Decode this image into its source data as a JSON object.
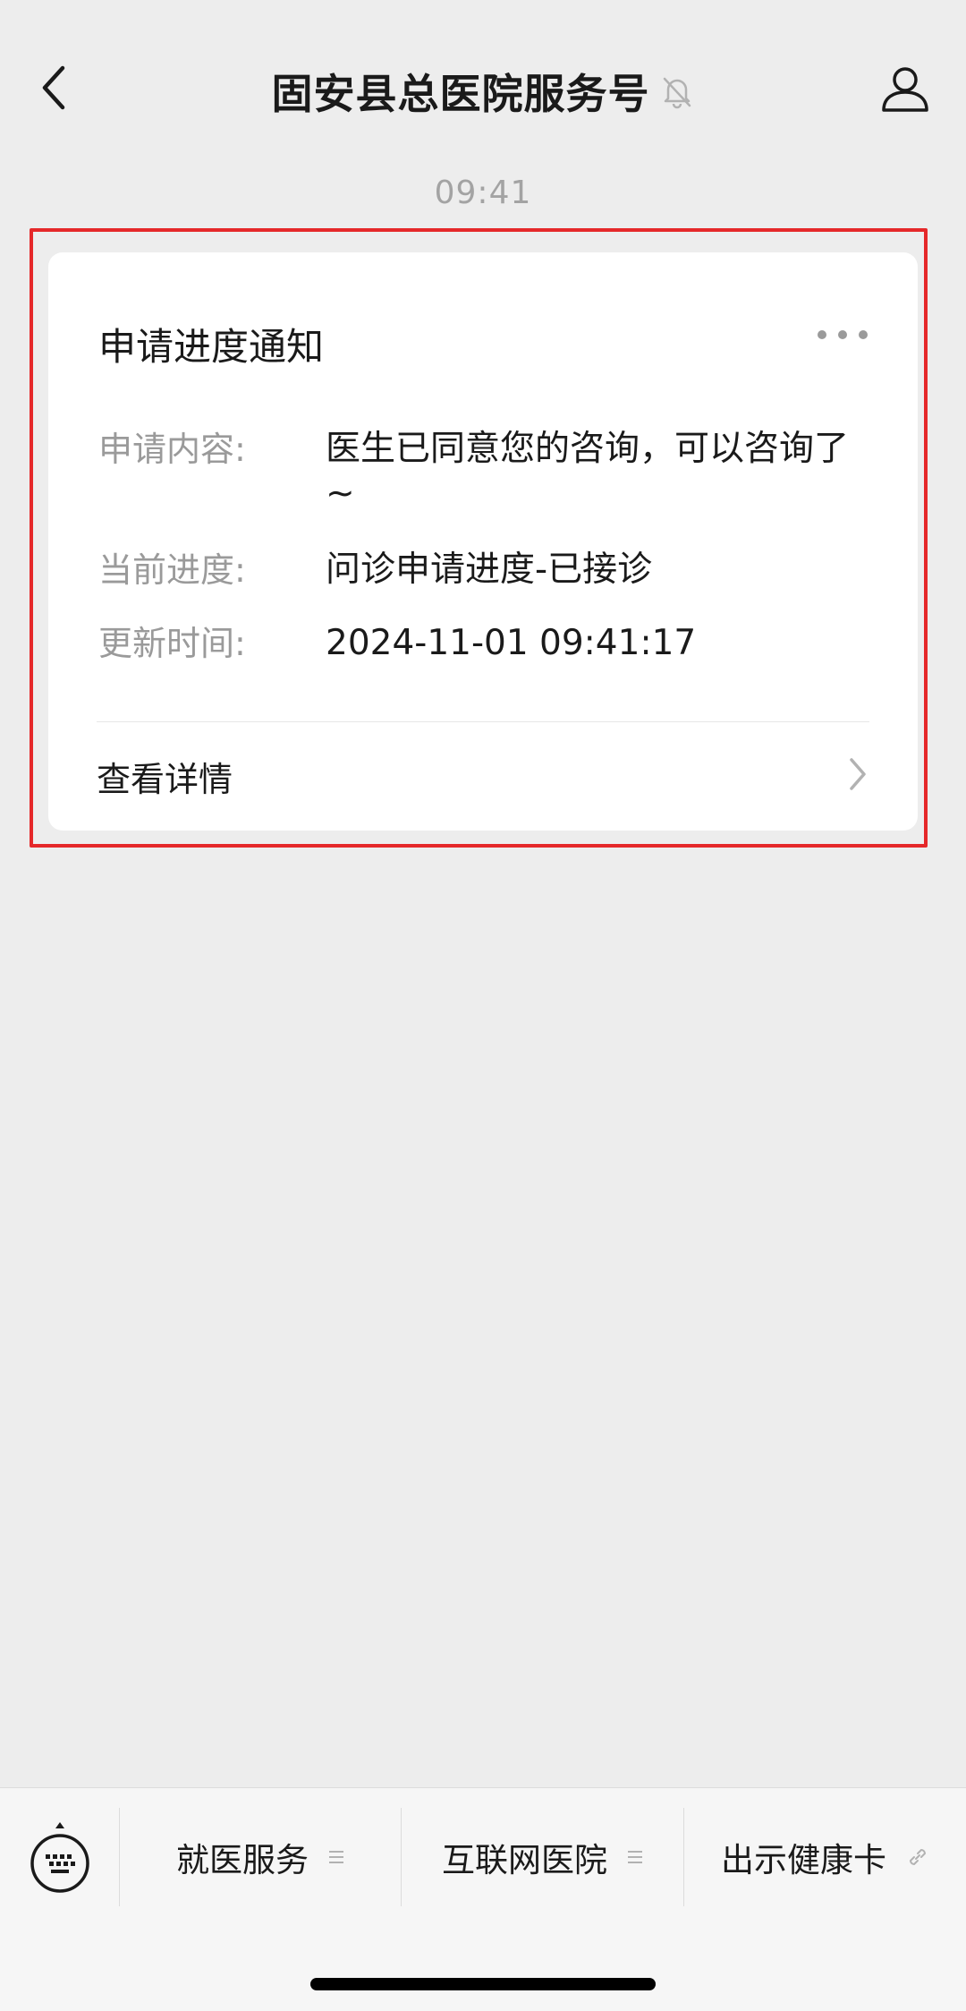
{
  "header": {
    "title": "固安县总医院服务号",
    "back_icon": "chevron-left-icon",
    "mute_icon": "bell-slash-icon",
    "profile_icon": "person-icon"
  },
  "timestamp": "09:41",
  "card": {
    "title": "申请进度通知",
    "more_icon": "ellipsis-icon",
    "rows": [
      {
        "label": "申请内容:",
        "value": "医生已同意您的咨询，可以咨询了~"
      },
      {
        "label": "当前进度:",
        "value": "问诊申请进度-已接诊"
      },
      {
        "label": "更新时间:",
        "value": "2024-11-01 09:41:17"
      }
    ],
    "detail_label": "查看详情",
    "detail_icon": "chevron-right-icon"
  },
  "menu": {
    "keyboard_icon": "keyboard-icon",
    "items": [
      {
        "label": "就医服务",
        "icon": "menu-lines-icon"
      },
      {
        "label": "互联网医院",
        "icon": "menu-lines-icon"
      },
      {
        "label": "出示健康卡",
        "icon": "link-icon"
      }
    ]
  },
  "colors": {
    "background": "#ededed",
    "card": "#ffffff",
    "highlight": "#e5282a",
    "muted_text": "#9a9a9a"
  }
}
